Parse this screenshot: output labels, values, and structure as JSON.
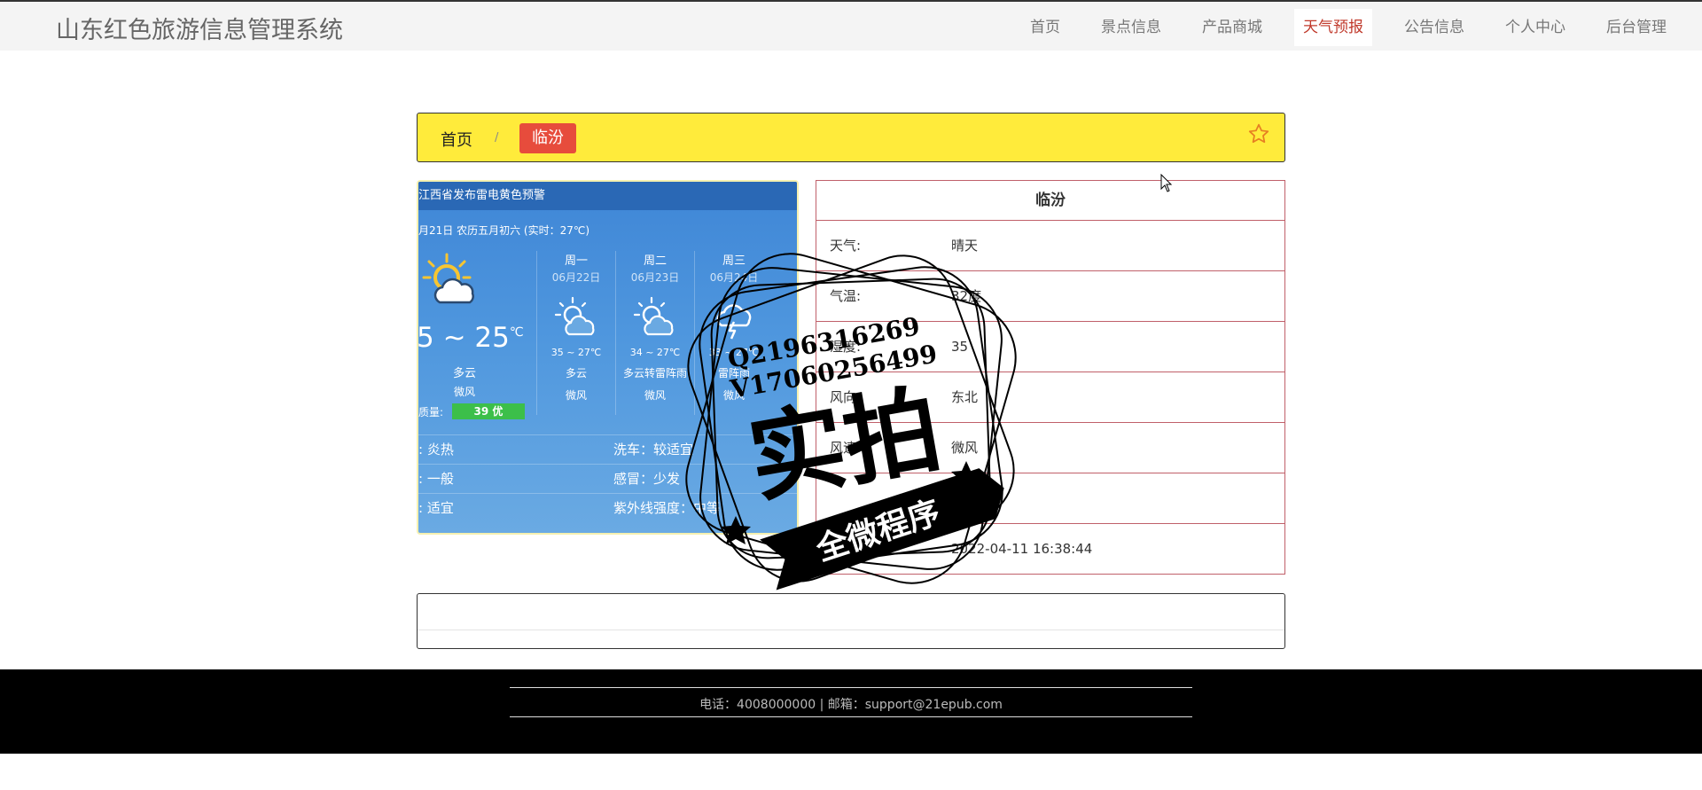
{
  "app": {
    "title": "山东红色旅游信息管理系统"
  },
  "nav": {
    "items": [
      {
        "label": "首页"
      },
      {
        "label": "景点信息"
      },
      {
        "label": "产品商城"
      },
      {
        "label": "天气预报",
        "active": true
      },
      {
        "label": "公告信息"
      },
      {
        "label": "个人中心"
      },
      {
        "label": "后台管理"
      }
    ]
  },
  "breadcrumb": {
    "home": "首页",
    "separator": "/",
    "current": "临汾"
  },
  "weather_widget": {
    "alert": "江西省发布雷电黄色预警",
    "date_line": "月21日 农历五月初六 (实时：27℃)",
    "today": {
      "temp": "5 ~ 25",
      "unit": "℃",
      "condition": "多云",
      "wind": "微风",
      "aqi_label": "质量:",
      "aqi": "39 优"
    },
    "forecast": [
      {
        "day": "周一",
        "date": "06月22日",
        "range": "35 ~ 27℃",
        "condition": "多云",
        "wind": "微风",
        "icon": "partly-cloudy-icon"
      },
      {
        "day": "周二",
        "date": "06月23日",
        "range": "34 ~ 27℃",
        "condition": "多云转雷阵雨",
        "wind": "微风",
        "icon": "partly-cloudy-icon"
      },
      {
        "day": "周三",
        "date": "06月24日",
        "range": "33 ~ 27℃",
        "condition": "雷阵雨",
        "wind": "微风",
        "icon": "thunderstorm-icon"
      }
    ],
    "tips": [
      {
        "left": ": 炎热",
        "right": "洗车：较适宜"
      },
      {
        "left": ": 一般",
        "right": "感冒：少发"
      },
      {
        "left": ": 适宜",
        "right": "紫外线强度：中等"
      }
    ]
  },
  "detail": {
    "city": "临汾",
    "rows": [
      {
        "label": "天气:",
        "value": "晴天"
      },
      {
        "label": "气温:",
        "value": "32度"
      },
      {
        "label": "湿度:",
        "value": "35"
      },
      {
        "label": "风向:",
        "value": "东北"
      },
      {
        "label": "风速:",
        "value": "微风"
      },
      {
        "label": "",
        "value": "无变化"
      },
      {
        "label": "更新时间:",
        "value": "2022-04-11 16:38:44"
      }
    ]
  },
  "footer": {
    "text": "电话：4008000000 | 邮箱：support@21epub.com"
  },
  "watermark": {
    "line1": "Q2196316269",
    "line2": "V17060256499",
    "main": "实拍",
    "ribbon": "全微程序"
  },
  "colors": {
    "accent": "#e74c3c",
    "breadcrumb_bg": "#ffeb3b",
    "nav_active": "#c0392b"
  }
}
